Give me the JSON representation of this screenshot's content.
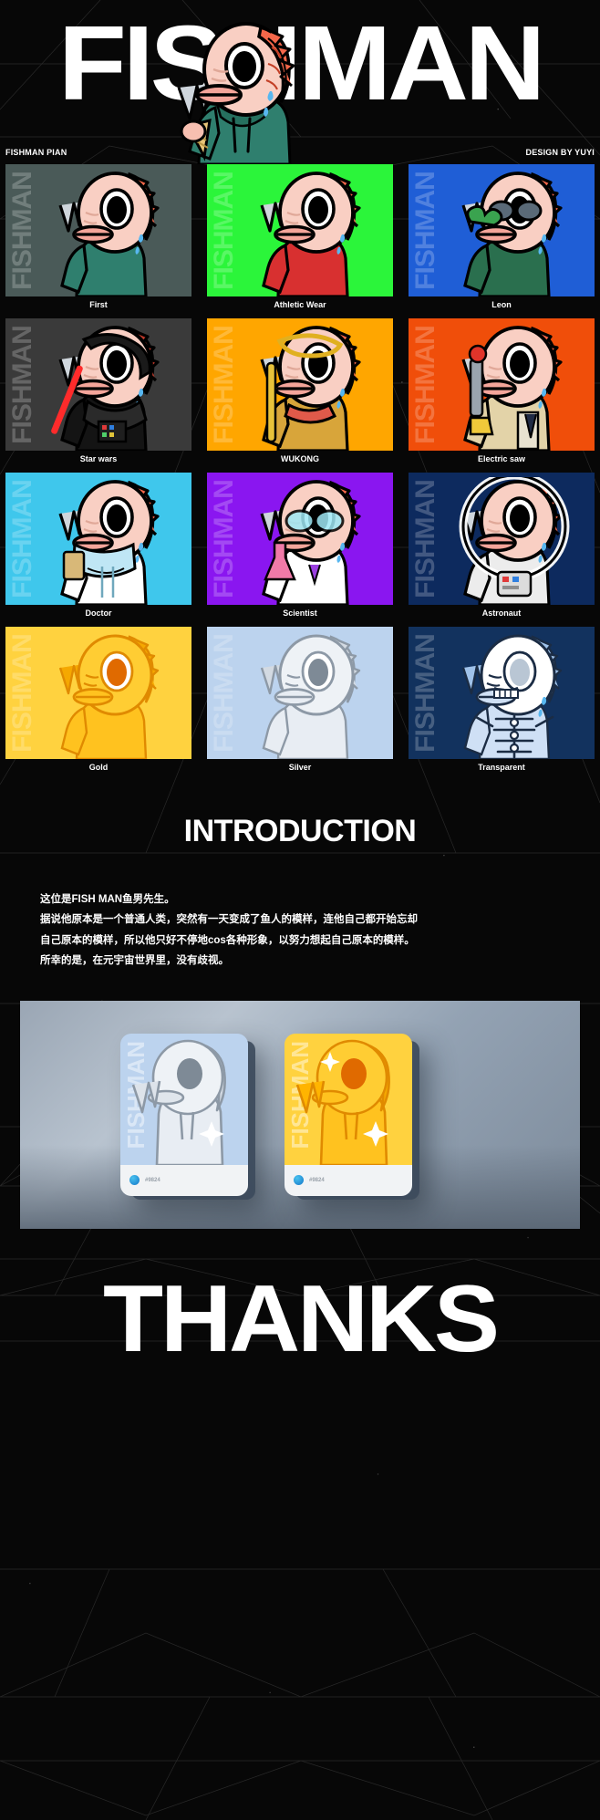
{
  "hero": {
    "title": "FISHMAN",
    "left_meta": "FISHMAN PIAN",
    "right_meta": "DESIGN BY YUYI",
    "watermark": "FISHMAN"
  },
  "grid": {
    "watermark": "FISHMAN",
    "rows": [
      [
        {
          "label": "First",
          "bg": "#4a5a58",
          "accent": "#3c4a48",
          "art": "hoodie-teal"
        },
        {
          "label": "Athletic Wear",
          "bg": "#2bf53a",
          "accent": "#57f763",
          "art": "tracksuit-red"
        },
        {
          "label": "Leon",
          "bg": "#1f5ed6",
          "accent": "#2f6fe8",
          "art": "leon-glasses"
        }
      ],
      [
        {
          "label": "Star wars",
          "bg": "#3a3a3a",
          "accent": "#4d4d4d",
          "art": "darth-vader"
        },
        {
          "label": "WUKONG",
          "bg": "#ffa600",
          "accent": "#ffb933",
          "art": "wukong-staff"
        },
        {
          "label": "Electric saw",
          "bg": "#f04e0a",
          "accent": "#ff6a2a",
          "art": "chainsaw"
        }
      ],
      [
        {
          "label": "Doctor",
          "bg": "#3fc7ec",
          "accent": "#62d4f1",
          "art": "doctor-mask"
        },
        {
          "label": "Scientist",
          "bg": "#8a16f0",
          "accent": "#a03cf5",
          "art": "scientist-flask"
        },
        {
          "label": "Astronaut",
          "bg": "#0d2a5e",
          "accent": "#16407f",
          "art": "astronaut-suit"
        }
      ],
      [
        {
          "label": "Gold",
          "bg": "#ffd23f",
          "accent": "#ffdd6b",
          "art": "gold-statue"
        },
        {
          "label": "Silver",
          "bg": "#bcd3ee",
          "accent": "#d3e2f4",
          "art": "silver-statue"
        },
        {
          "label": "Transparent",
          "bg": "#12325e",
          "accent": "#1d4a86",
          "art": "skeleton-xray"
        }
      ]
    ]
  },
  "intro": {
    "title": "INTRODUCTION",
    "lines": [
      "这位是FISH MAN鱼男先生。",
      "据说他原本是一个普通人类，突然有一天变成了鱼人的模样，连他自己都开始忘却",
      "自己原本的模样，所以他只好不停地cos各种形象，以努力想起自己原本的模样。",
      "所幸的是，在元宇宙世界里，没有歧视。"
    ]
  },
  "showcase": {
    "watermark": "FISHMAN",
    "cards": [
      {
        "id": "#9824",
        "bg": "#bcd3ee",
        "art": "silver-statue"
      },
      {
        "id": "#9824",
        "bg": "#ffd23f",
        "art": "gold-statue"
      }
    ]
  },
  "footer": {
    "thanks": "THANKS"
  },
  "colors": {
    "background": "#070707",
    "text": "#ffffff",
    "fish_skin": "#f9cfc3",
    "fish_fin": "#f4674a",
    "tear": "#58b7f0"
  }
}
